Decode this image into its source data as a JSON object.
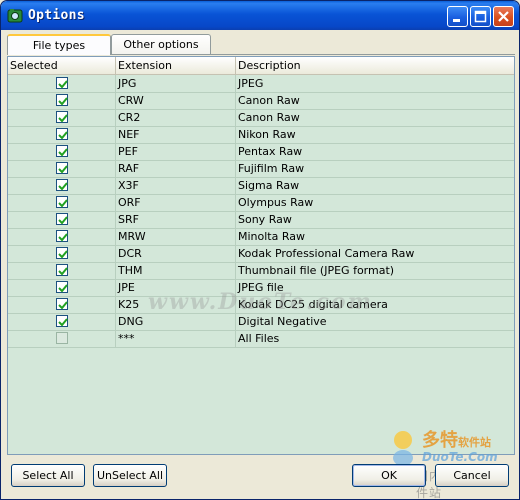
{
  "window": {
    "title": "Options"
  },
  "tabs": [
    {
      "label": "File types",
      "active": true
    },
    {
      "label": "Other options",
      "active": false
    }
  ],
  "grid": {
    "columns": [
      "Selected",
      "Extension",
      "Description"
    ],
    "rows": [
      {
        "selected": true,
        "extension": "JPG",
        "description": "JPEG"
      },
      {
        "selected": true,
        "extension": "CRW",
        "description": "Canon Raw"
      },
      {
        "selected": true,
        "extension": "CR2",
        "description": "Canon Raw"
      },
      {
        "selected": true,
        "extension": "NEF",
        "description": "Nikon Raw"
      },
      {
        "selected": true,
        "extension": "PEF",
        "description": "Pentax Raw"
      },
      {
        "selected": true,
        "extension": "RAF",
        "description": "Fujifilm Raw"
      },
      {
        "selected": true,
        "extension": "X3F",
        "description": "Sigma Raw"
      },
      {
        "selected": true,
        "extension": "ORF",
        "description": "Olympus Raw"
      },
      {
        "selected": true,
        "extension": "SRF",
        "description": "Sony Raw"
      },
      {
        "selected": true,
        "extension": "MRW",
        "description": "Minolta Raw"
      },
      {
        "selected": true,
        "extension": "DCR",
        "description": "Kodak Professional Camera Raw"
      },
      {
        "selected": true,
        "extension": "THM",
        "description": "Thumbnail file (JPEG format)"
      },
      {
        "selected": true,
        "extension": "JPE",
        "description": "JPEG file"
      },
      {
        "selected": true,
        "extension": "K25",
        "description": "Kodak DC25 digital camera"
      },
      {
        "selected": true,
        "extension": "DNG",
        "description": "Digital Negative"
      },
      {
        "selected": false,
        "extension": "***",
        "description": "All Files"
      }
    ]
  },
  "buttons": {
    "select_all": "Select All",
    "unselect_all": "UnSelect All",
    "ok": "OK",
    "cancel": "Cancel"
  },
  "watermark": {
    "site": "www.DuoTe.com",
    "logo_title": "多特",
    "logo_title_suffix": "软件站",
    "logo_url": "DuoTe.Com",
    "logo_tagline": "国内最安全的软件站"
  },
  "colors": {
    "grid_background": "#d3e7d9",
    "titlebar": "#0954d6",
    "close_button": "#d9501f"
  }
}
